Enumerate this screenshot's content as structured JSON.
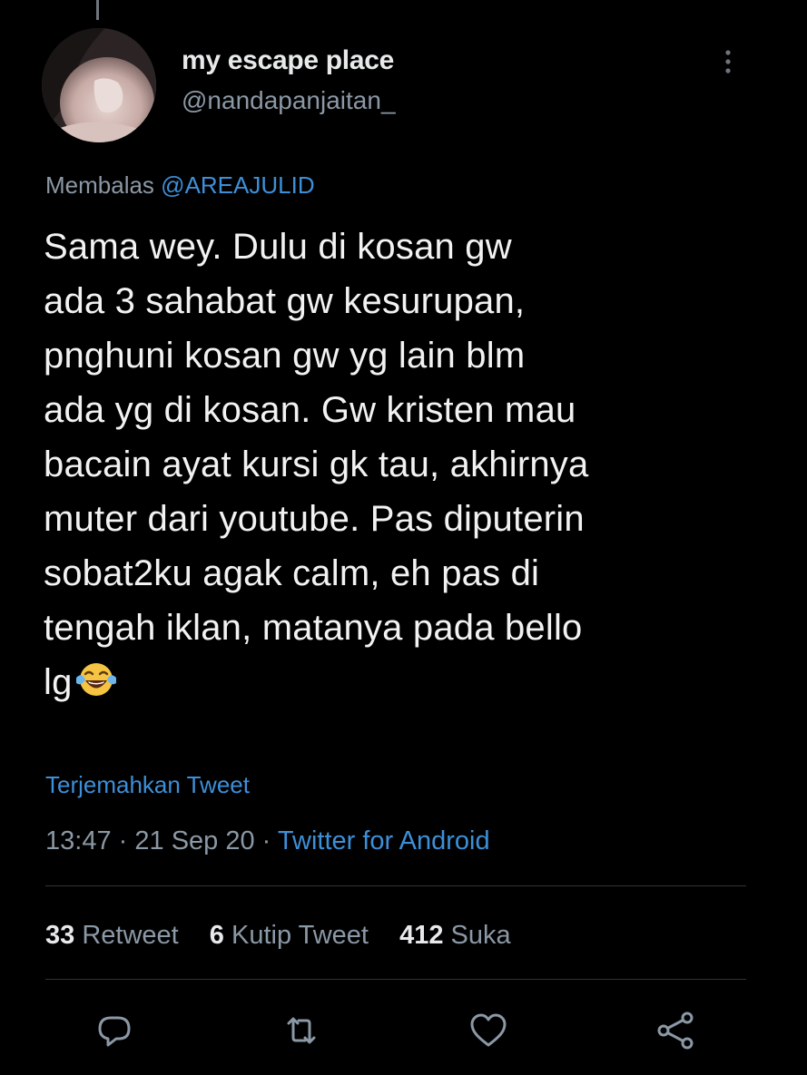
{
  "tweet": {
    "display_name": "my escape place",
    "handle": "@nandapanjaitan_",
    "reply_prefix": "Membalas",
    "reply_to": "@AREAJULID",
    "lines": [
      "Sama wey. Dulu di kosan gw",
      "ada 3 sahabat gw kesurupan,",
      "pnghuni kosan gw yg lain blm",
      "ada yg di kosan. Gw kristen mau",
      "bacain ayat kursi gk tau, akhirnya",
      "muter dari youtube. Pas diputerin",
      "sobat2ku agak calm, eh pas di",
      "tengah iklan, matanya pada bello",
      "lg"
    ],
    "emoji": "face-with-tears-of-joy",
    "translate_label": "Terjemahkan Tweet",
    "time": "13:47",
    "separator": "·",
    "date": "21 Sep 20",
    "source": "Twitter for Android"
  },
  "stats": {
    "retweet_count": "33",
    "retweet_label": "Retweet",
    "quote_count": "6",
    "quote_label": "Kutip Tweet",
    "like_count": "412",
    "like_label": "Suka"
  },
  "actions": {
    "reply_icon": "speech-bubble-icon",
    "retweet_icon": "retweet-icon",
    "like_icon": "heart-icon",
    "share_icon": "share-icon"
  },
  "colors": {
    "background": "#000000",
    "text": "#e7e9ea",
    "secondary": "#8b98a5",
    "link": "#3d8fd8",
    "divider": "#2f3336"
  }
}
